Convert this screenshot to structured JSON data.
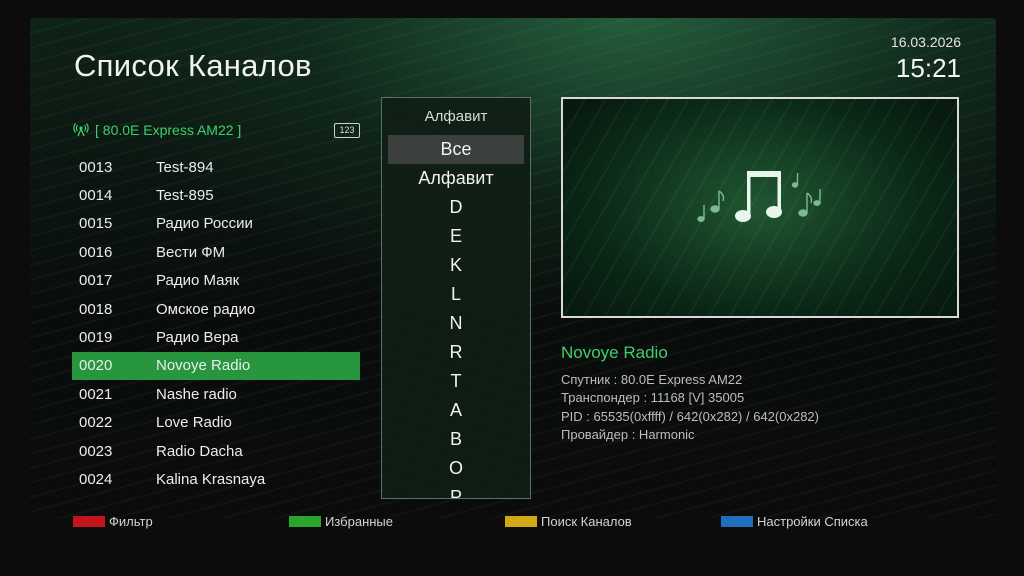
{
  "header": {
    "title": "Список Каналов",
    "date": "16.03.2026",
    "time": "15:21"
  },
  "satellite": {
    "label": "[ 80.0E Express AM22 ]",
    "badge": "123",
    "icon": "satellite-dish-icon"
  },
  "channels": [
    {
      "num": "0013",
      "name": "Test-894"
    },
    {
      "num": "0014",
      "name": "Test-895"
    },
    {
      "num": "0015",
      "name": "Радио России"
    },
    {
      "num": "0016",
      "name": "Вести ФМ"
    },
    {
      "num": "0017",
      "name": "Радио Маяк"
    },
    {
      "num": "0018",
      "name": "Омское радио"
    },
    {
      "num": "0019",
      "name": "Радио Вера"
    },
    {
      "num": "0020",
      "name": "Novoye Radio",
      "selected": true
    },
    {
      "num": "0021",
      "name": "Nashe radio"
    },
    {
      "num": "0022",
      "name": "Love Radio"
    },
    {
      "num": "0023",
      "name": "Radio Dacha"
    },
    {
      "num": "0024",
      "name": "Kalina Krasnaya"
    }
  ],
  "sort_menu": {
    "title": "Алфавит",
    "items": [
      "Все",
      "Алфавит",
      "D",
      "E",
      "K",
      "L",
      "N",
      "R",
      "T",
      "A",
      "B",
      "O",
      "P"
    ],
    "selected_index": 0
  },
  "preview": {
    "icon": "music-notes-icon"
  },
  "channel_info": {
    "name": "Novoye Radio",
    "satellite": "Спутник : 80.0E Express AM22",
    "transponder": "Транспондер : 11168 [V] 35005",
    "pid": "PID : 65535(0xffff) / 642(0x282) / 642(0x282)",
    "provider": "Провайдер : Harmonic"
  },
  "footer": [
    {
      "label": "Фильтр",
      "color": "#c4141c"
    },
    {
      "label": "Избранные",
      "color": "#2aa62e"
    },
    {
      "label": "Поиск Каналов",
      "color": "#d2a814"
    },
    {
      "label": "Настройки Списка",
      "color": "#1f6fc0"
    }
  ]
}
